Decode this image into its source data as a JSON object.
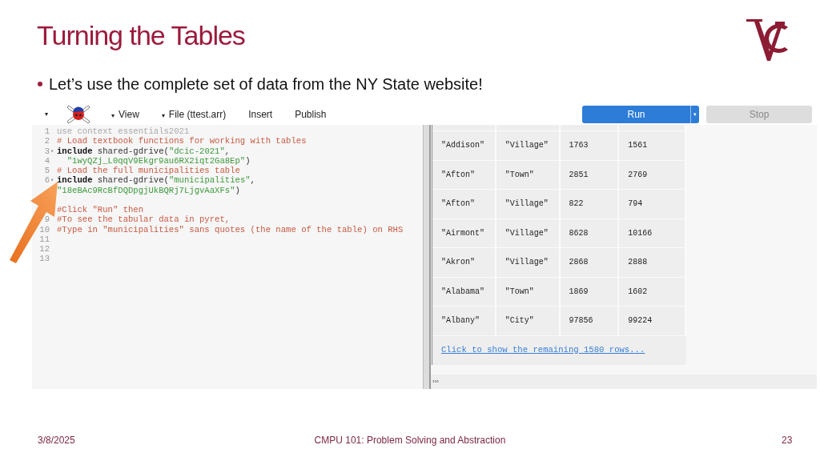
{
  "slide": {
    "title": "Turning the Tables",
    "bullets": [
      "Let’s use the complete set of data from the NY State website!"
    ],
    "footer": {
      "date": "3/8/2025",
      "course": "CMPU 101: Problem Solving and Abstraction",
      "page": "23"
    }
  },
  "toolbar": {
    "menu_caret": "▾",
    "menus": [
      {
        "label": "View",
        "caret": "▾"
      },
      {
        "label": "File (ttest.arr)",
        "caret": "▾"
      },
      {
        "label": "Insert"
      },
      {
        "label": "Publish"
      }
    ],
    "run": {
      "label": "Run",
      "caret": "▾"
    },
    "stop": {
      "label": "Stop",
      "disabled": true
    }
  },
  "editor": {
    "lines": [
      {
        "number": "1",
        "segments": [
          {
            "kind": "context",
            "text": "use context essentials2021"
          }
        ]
      },
      {
        "number": "2",
        "segments": [
          {
            "kind": "comment",
            "text": "# Load textbook functions for working with tables"
          }
        ]
      },
      {
        "number": "3",
        "fold_marker": "▾",
        "segments": [
          {
            "kind": "keyword",
            "text": "include"
          },
          {
            "kind": "plain",
            "text": " shared-gdrive("
          },
          {
            "kind": "string",
            "text": "\"dcic-2021\""
          },
          {
            "kind": "plain",
            "text": ","
          }
        ]
      },
      {
        "number": "4",
        "indent": true,
        "segments": [
          {
            "kind": "string",
            "text": "\"1wyQZj_L0qqV9Ekgr9au6RX2iqt2Ga8Ep\""
          },
          {
            "kind": "plain",
            "text": ")"
          }
        ]
      },
      {
        "number": "5",
        "segments": [
          {
            "kind": "comment",
            "text": "# Load the full municipalities table"
          }
        ]
      },
      {
        "number": "6",
        "fold_marker": "▾",
        "segments": [
          {
            "kind": "keyword",
            "text": "include"
          },
          {
            "kind": "plain",
            "text": " shared-gdrive("
          },
          {
            "kind": "string",
            "text": "\"municipalities\""
          },
          {
            "kind": "plain",
            "text": ","
          }
        ]
      },
      {
        "segments": [
          {
            "kind": "string",
            "text": "\"18eBAc9RcBfDQDpgjUkBQRj7LjgvAaXFs\""
          },
          {
            "kind": "plain",
            "text": ")"
          }
        ]
      },
      {
        "blank_line_before": true,
        "segments": [
          {
            "kind": "comment",
            "text": "#Click \"Run\" then"
          }
        ]
      },
      {
        "number": "9",
        "segments": [
          {
            "kind": "comment",
            "text": "#To see the tabular data in pyret,"
          }
        ]
      },
      {
        "number": "10",
        "segments": [
          {
            "kind": "comment",
            "text": "#Type in \"municipalities\" sans quotes (the name of the table) on RHS"
          }
        ]
      },
      {
        "number": "11"
      },
      {
        "number": "12"
      },
      {
        "number": "13"
      }
    ]
  },
  "interactions": {
    "rows": [
      [
        "\"Addison\"",
        "\"Village\"",
        "1763",
        "1561"
      ],
      [
        "\"Afton\"",
        "\"Town\"",
        "2851",
        "2769"
      ],
      [
        "\"Afton\"",
        "\"Village\"",
        "822",
        "794"
      ],
      [
        "\"Airmont\"",
        "\"Village\"",
        "8628",
        "10166"
      ],
      [
        "\"Akron\"",
        "\"Village\"",
        "2868",
        "2888"
      ],
      [
        "\"Alabama\"",
        "\"Town\"",
        "1869",
        "1602"
      ],
      [
        "\"Albany\"",
        "\"City\"",
        "97856",
        "99224"
      ]
    ],
    "more_link": "Click to show the remaining 1580 rows...",
    "prompt": "›››"
  }
}
